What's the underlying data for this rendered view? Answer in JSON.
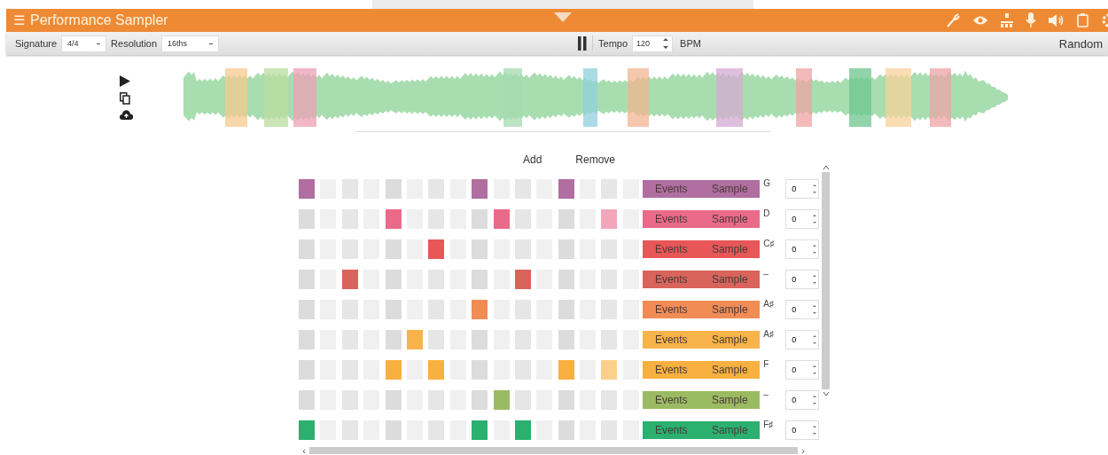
{
  "app_bar": {
    "menu_icon": "☰",
    "title": "Performance Sampler"
  },
  "toolbar": {
    "signature": {
      "label": "Signature",
      "value": "4/4"
    },
    "resolution": {
      "label": "Resolution",
      "value": "16ths"
    },
    "tempo": {
      "label": "Tempo",
      "value": "120",
      "unit": "BPM"
    },
    "random": "Random"
  },
  "pattern_actions": [
    "Add",
    "Remove"
  ],
  "scroll_arrows": {
    "left": "‹",
    "right": "›"
  },
  "tracks": [
    {
      "color": "#b06fa0",
      "steps": [
        {
          "on": true,
          "faded": false
        },
        {
          "on": false,
          "faded": false
        },
        {
          "on": false,
          "faded": false
        },
        {
          "on": false,
          "faded": false
        },
        {
          "on": false,
          "faded": false
        },
        {
          "on": false,
          "faded": false
        },
        {
          "on": false,
          "faded": false
        },
        {
          "on": false,
          "faded": false
        },
        {
          "on": true,
          "faded": false
        },
        {
          "on": false,
          "faded": false
        },
        {
          "on": false,
          "faded": false
        },
        {
          "on": false,
          "faded": false
        },
        {
          "on": true,
          "faded": false
        },
        {
          "on": false,
          "faded": false
        },
        {
          "on": false,
          "faded": false
        },
        {
          "on": false,
          "faded": false
        }
      ],
      "events": "Events",
      "sample": "Sample",
      "note": "G",
      "value": "0"
    },
    {
      "color": "#ea6a8a",
      "steps": [
        {
          "on": false,
          "faded": false
        },
        {
          "on": false,
          "faded": false
        },
        {
          "on": false,
          "faded": false
        },
        {
          "on": false,
          "faded": false
        },
        {
          "on": true,
          "faded": false
        },
        {
          "on": false,
          "faded": false
        },
        {
          "on": false,
          "faded": false
        },
        {
          "on": false,
          "faded": false
        },
        {
          "on": false,
          "faded": false
        },
        {
          "on": true,
          "faded": false
        },
        {
          "on": false,
          "faded": false
        },
        {
          "on": false,
          "faded": false
        },
        {
          "on": false,
          "faded": false
        },
        {
          "on": false,
          "faded": false
        },
        {
          "on": true,
          "faded": true
        },
        {
          "on": false,
          "faded": false
        }
      ],
      "events": "Events",
      "sample": "Sample",
      "note": "D",
      "value": "0"
    },
    {
      "color": "#e85658",
      "steps": [
        {
          "on": false,
          "faded": false
        },
        {
          "on": false,
          "faded": false
        },
        {
          "on": false,
          "faded": false
        },
        {
          "on": false,
          "faded": false
        },
        {
          "on": false,
          "faded": false
        },
        {
          "on": false,
          "faded": false
        },
        {
          "on": true,
          "faded": false
        },
        {
          "on": false,
          "faded": false
        },
        {
          "on": false,
          "faded": false
        },
        {
          "on": false,
          "faded": false
        },
        {
          "on": false,
          "faded": false
        },
        {
          "on": false,
          "faded": false
        },
        {
          "on": false,
          "faded": false
        },
        {
          "on": false,
          "faded": false
        },
        {
          "on": false,
          "faded": false
        },
        {
          "on": false,
          "faded": false
        }
      ],
      "events": "Events",
      "sample": "Sample",
      "note": "C♯",
      "value": "0"
    },
    {
      "color": "#d9645b",
      "steps": [
        {
          "on": false,
          "faded": false
        },
        {
          "on": false,
          "faded": false
        },
        {
          "on": true,
          "faded": false
        },
        {
          "on": false,
          "faded": false
        },
        {
          "on": false,
          "faded": false
        },
        {
          "on": false,
          "faded": false
        },
        {
          "on": false,
          "faded": false
        },
        {
          "on": false,
          "faded": false
        },
        {
          "on": false,
          "faded": false
        },
        {
          "on": false,
          "faded": false
        },
        {
          "on": true,
          "faded": false
        },
        {
          "on": false,
          "faded": false
        },
        {
          "on": false,
          "faded": false
        },
        {
          "on": false,
          "faded": false
        },
        {
          "on": false,
          "faded": false
        },
        {
          "on": false,
          "faded": false
        }
      ],
      "events": "Events",
      "sample": "Sample",
      "note": "–",
      "value": "0"
    },
    {
      "color": "#f18c55",
      "steps": [
        {
          "on": false,
          "faded": false
        },
        {
          "on": false,
          "faded": false
        },
        {
          "on": false,
          "faded": false
        },
        {
          "on": false,
          "faded": false
        },
        {
          "on": false,
          "faded": false
        },
        {
          "on": false,
          "faded": false
        },
        {
          "on": false,
          "faded": false
        },
        {
          "on": false,
          "faded": false
        },
        {
          "on": true,
          "faded": false
        },
        {
          "on": false,
          "faded": false
        },
        {
          "on": false,
          "faded": false
        },
        {
          "on": false,
          "faded": false
        },
        {
          "on": false,
          "faded": false
        },
        {
          "on": false,
          "faded": false
        },
        {
          "on": false,
          "faded": false
        },
        {
          "on": false,
          "faded": false
        }
      ],
      "events": "Events",
      "sample": "Sample",
      "note": "A♯",
      "value": "0"
    },
    {
      "color": "#f8b34a",
      "steps": [
        {
          "on": false,
          "faded": false
        },
        {
          "on": false,
          "faded": false
        },
        {
          "on": false,
          "faded": false
        },
        {
          "on": false,
          "faded": false
        },
        {
          "on": false,
          "faded": false
        },
        {
          "on": true,
          "faded": false
        },
        {
          "on": false,
          "faded": false
        },
        {
          "on": false,
          "faded": false
        },
        {
          "on": false,
          "faded": false
        },
        {
          "on": false,
          "faded": false
        },
        {
          "on": false,
          "faded": false
        },
        {
          "on": false,
          "faded": false
        },
        {
          "on": false,
          "faded": false
        },
        {
          "on": false,
          "faded": false
        },
        {
          "on": false,
          "faded": false
        },
        {
          "on": false,
          "faded": false
        }
      ],
      "events": "Events",
      "sample": "Sample",
      "note": "A♯",
      "value": "0"
    },
    {
      "color": "#f8b040",
      "steps": [
        {
          "on": false,
          "faded": false
        },
        {
          "on": false,
          "faded": false
        },
        {
          "on": false,
          "faded": false
        },
        {
          "on": false,
          "faded": false
        },
        {
          "on": true,
          "faded": false
        },
        {
          "on": false,
          "faded": false
        },
        {
          "on": true,
          "faded": false
        },
        {
          "on": false,
          "faded": false
        },
        {
          "on": false,
          "faded": false
        },
        {
          "on": false,
          "faded": false
        },
        {
          "on": false,
          "faded": false
        },
        {
          "on": false,
          "faded": false
        },
        {
          "on": true,
          "faded": false
        },
        {
          "on": false,
          "faded": false
        },
        {
          "on": true,
          "faded": true
        },
        {
          "on": false,
          "faded": false
        }
      ],
      "events": "Events",
      "sample": "Sample",
      "note": "F",
      "value": "0"
    },
    {
      "color": "#9bbb63",
      "steps": [
        {
          "on": false,
          "faded": false
        },
        {
          "on": false,
          "faded": false
        },
        {
          "on": false,
          "faded": false
        },
        {
          "on": false,
          "faded": false
        },
        {
          "on": false,
          "faded": false
        },
        {
          "on": false,
          "faded": false
        },
        {
          "on": false,
          "faded": false
        },
        {
          "on": false,
          "faded": false
        },
        {
          "on": false,
          "faded": false
        },
        {
          "on": true,
          "faded": false
        },
        {
          "on": false,
          "faded": false
        },
        {
          "on": false,
          "faded": false
        },
        {
          "on": false,
          "faded": false
        },
        {
          "on": false,
          "faded": false
        },
        {
          "on": false,
          "faded": false
        },
        {
          "on": false,
          "faded": false
        }
      ],
      "events": "Events",
      "sample": "Sample",
      "note": "–",
      "value": "0"
    },
    {
      "color": "#2bb06f",
      "steps": [
        {
          "on": true,
          "faded": false
        },
        {
          "on": false,
          "faded": false
        },
        {
          "on": false,
          "faded": false
        },
        {
          "on": false,
          "faded": false
        },
        {
          "on": false,
          "faded": false
        },
        {
          "on": false,
          "faded": false
        },
        {
          "on": false,
          "faded": false
        },
        {
          "on": false,
          "faded": false
        },
        {
          "on": true,
          "faded": false
        },
        {
          "on": false,
          "faded": false
        },
        {
          "on": true,
          "faded": false
        },
        {
          "on": false,
          "faded": false
        },
        {
          "on": false,
          "faded": false
        },
        {
          "on": false,
          "faded": false
        },
        {
          "on": false,
          "faded": false
        },
        {
          "on": false,
          "faded": false
        }
      ],
      "events": "Events",
      "sample": "Sample",
      "note": "F♯",
      "value": "0"
    }
  ]
}
